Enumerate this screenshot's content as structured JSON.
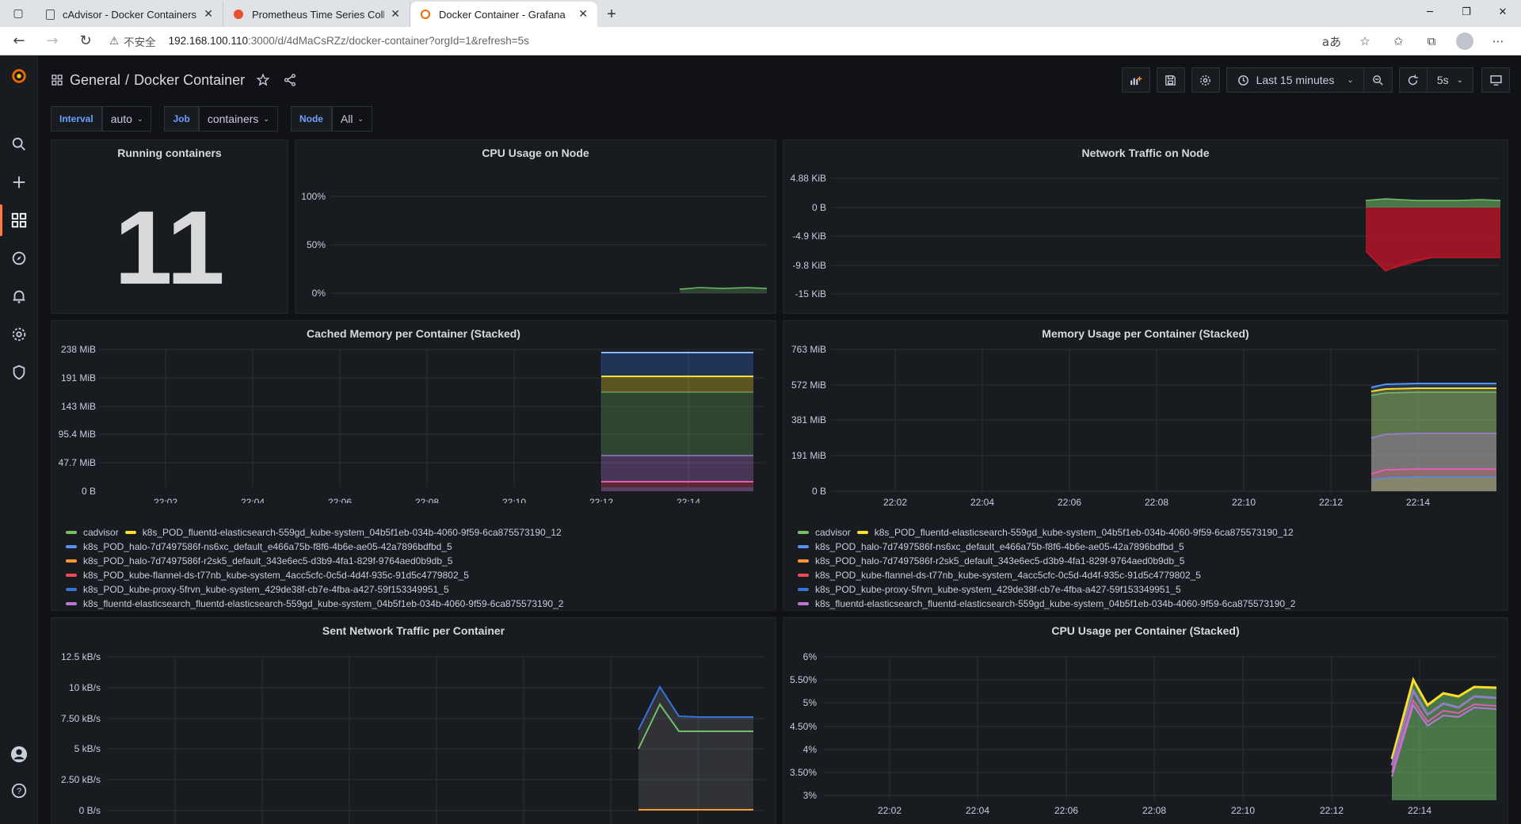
{
  "browser": {
    "tabs": [
      {
        "title": "cAdvisor - Docker Containers",
        "active": false,
        "favicon": "page-icon"
      },
      {
        "title": "Prometheus Time Series Collectio",
        "active": false,
        "favicon": "prometheus-icon"
      },
      {
        "title": "Docker Container - Grafana",
        "active": true,
        "favicon": "grafana-icon"
      }
    ],
    "url_insecure_label": "不安全",
    "url_host": "192.168.100.110",
    "url_rest": ":3000/d/4dMaCsRZz/docker-container?orgId=1&refresh=5s"
  },
  "dashboard": {
    "folder": "General",
    "title": "Docker Container",
    "time_range": "Last 15 minutes",
    "refresh": "5s"
  },
  "variables": [
    {
      "label": "Interval",
      "value": "auto"
    },
    {
      "label": "Job",
      "value": "containers"
    },
    {
      "label": "Node",
      "value": "All"
    }
  ],
  "panels": {
    "running": {
      "title": "Running containers",
      "value": "11"
    },
    "cpu_node": {
      "title": "CPU Usage on Node"
    },
    "net_node": {
      "title": "Network Traffic on Node"
    },
    "cached_mem": {
      "title": "Cached Memory per Container (Stacked)"
    },
    "mem_usage": {
      "title": "Memory Usage per Container (Stacked)"
    },
    "sent_net": {
      "title": "Sent Network Traffic per Container"
    },
    "cpu_container": {
      "title": "CPU Usage per Container (Stacked)"
    }
  },
  "legend": [
    {
      "name": "cadvisor",
      "color": "#73bf69"
    },
    {
      "name": "k8s_POD_fluentd-elasticsearch-559gd_kube-system_04b5f1eb-034b-4060-9f59-6ca875573190_12",
      "color": "#fade2a"
    },
    {
      "name": "k8s_POD_halo-7d7497586f-ns6xc_default_e466a75b-f8f6-4b6e-ae05-42a7896bdfbd_5",
      "color": "#5794f2"
    },
    {
      "name": "k8s_POD_halo-7d7497586f-r2sk5_default_343e6ec5-d3b9-4fa1-829f-9764aed0b9db_5",
      "color": "#ff9830"
    },
    {
      "name": "k8s_POD_kube-flannel-ds-t77nb_kube-system_4acc5cfc-0c5d-4d4f-935c-91d5c4779802_5",
      "color": "#f2495c"
    },
    {
      "name": "k8s_POD_kube-proxy-5frvn_kube-system_429de38f-cb7e-4fba-a427-59f153349951_5",
      "color": "#3274d9"
    },
    {
      "name": "k8s_fluentd-elasticsearch_fluentd-elasticsearch-559gd_kube-system_04b5f1eb-034b-4060-9f59-6ca875573190_2",
      "color": "#b877d9"
    }
  ],
  "colors": {
    "green": "#73bf69",
    "yellow": "#fade2a",
    "lightblue": "#8ab8ff",
    "orange": "#ff9830",
    "red": "#f2495c",
    "blue": "#3274d9",
    "purple": "#b877d9",
    "darkred": "#c4162a",
    "grid": "#2c3037",
    "axis": "#ccccdc"
  },
  "chart_data": [
    {
      "name": "cpu_node",
      "type": "area",
      "title": "CPU Usage on Node",
      "yticks": [
        "100%",
        "50%",
        "0%"
      ],
      "ylim": [
        0,
        100
      ],
      "series": [
        {
          "name": "",
          "x": [
            "22:12",
            "22:14",
            "22:15"
          ],
          "values": [
            3,
            4,
            4
          ]
        }
      ]
    },
    {
      "name": "net_node",
      "type": "area",
      "title": "Network Traffic on Node",
      "yticks": [
        "4.88 KiB",
        "0 B",
        "-4.9 KiB",
        "-9.8 KiB",
        "-15 KiB"
      ],
      "ylim": [
        -15,
        4.88
      ],
      "series": [
        {
          "name": "",
          "x": [
            "22:12",
            "22:13",
            "22:14",
            "22:15"
          ],
          "values": [
            1.2,
            1.4,
            1.3,
            1.4
          ]
        },
        {
          "name": "",
          "x": [
            "22:12",
            "22:12:30",
            "22:13",
            "22:14",
            "22:15"
          ],
          "values": [
            -7,
            -10.5,
            -9,
            -8.5,
            -8.4
          ]
        }
      ]
    },
    {
      "name": "cached_mem",
      "type": "area",
      "title": "Cached Memory per Container (Stacked)",
      "xticks": [
        "22:02",
        "22:04",
        "22:06",
        "22:08",
        "22:10",
        "22:12",
        "22:14"
      ],
      "yticks": [
        "238 MiB",
        "191 MiB",
        "143 MiB",
        "95.4 MiB",
        "47.7 MiB",
        "0 B"
      ],
      "ylim": [
        0,
        238
      ],
      "stacked_tops_mib": {
        "purple": 5,
        "red": 10,
        "blue": 14,
        "green": 80,
        "yellow": 185,
        "lightblue": 232
      }
    },
    {
      "name": "mem_usage",
      "type": "area",
      "title": "Memory Usage per Container (Stacked)",
      "xticks": [
        "22:02",
        "22:04",
        "22:06",
        "22:08",
        "22:10",
        "22:12",
        "22:14"
      ],
      "yticks": [
        "763 MiB",
        "572 MiB",
        "381 MiB",
        "191 MiB",
        "0 B"
      ],
      "ylim": [
        0,
        763
      ],
      "stacked_tops_mib": {
        "blue": 95,
        "purple": 150,
        "green": 390,
        "yellow": 610,
        "lightblue": 650
      }
    },
    {
      "name": "sent_net",
      "type": "line",
      "title": "Sent Network Traffic per Container",
      "yticks": [
        "12.5 kB/s",
        "10 kB/s",
        "7.50 kB/s",
        "5 kB/s",
        "2.50 kB/s",
        "0 B/s"
      ],
      "ylim": [
        0,
        12.5
      ],
      "series": [
        {
          "name": "",
          "x": [
            "22:12:30",
            "22:13",
            "22:13:30",
            "22:14",
            "22:15"
          ],
          "values": [
            6.8,
            10.7,
            8.3,
            8.2,
            8.2
          ]
        },
        {
          "name": "",
          "x": [
            "22:12:30",
            "22:13",
            "22:13:30",
            "22:14",
            "22:15"
          ],
          "values": [
            5.2,
            8.8,
            6.5,
            6.5,
            6.5
          ]
        },
        {
          "name": "",
          "x": [
            "22:12:30",
            "22:15"
          ],
          "values": [
            0.1,
            0.1
          ]
        }
      ]
    },
    {
      "name": "cpu_container",
      "type": "area",
      "title": "CPU Usage per Container (Stacked)",
      "xticks": [
        "22:02",
        "22:04",
        "22:06",
        "22:08",
        "22:10",
        "22:12",
        "22:14"
      ],
      "yticks": [
        "6%",
        "5.50%",
        "5%",
        "4.50%",
        "4%",
        "3.50%",
        "3%"
      ],
      "ylim": [
        3,
        6
      ],
      "series": [
        {
          "name": "",
          "x": [
            "22:12:30",
            "22:13",
            "22:13:30",
            "22:14",
            "22:14:30",
            "22:15"
          ],
          "values": [
            3.8,
            5.5,
            4.8,
            5.1,
            5.0,
            5.25
          ]
        },
        {
          "name": "",
          "x": [
            "22:12:30",
            "22:13",
            "22:13:30",
            "22:14",
            "22:14:30",
            "22:15"
          ],
          "values": [
            3.4,
            5.0,
            4.3,
            4.6,
            4.5,
            4.8
          ]
        }
      ]
    }
  ]
}
